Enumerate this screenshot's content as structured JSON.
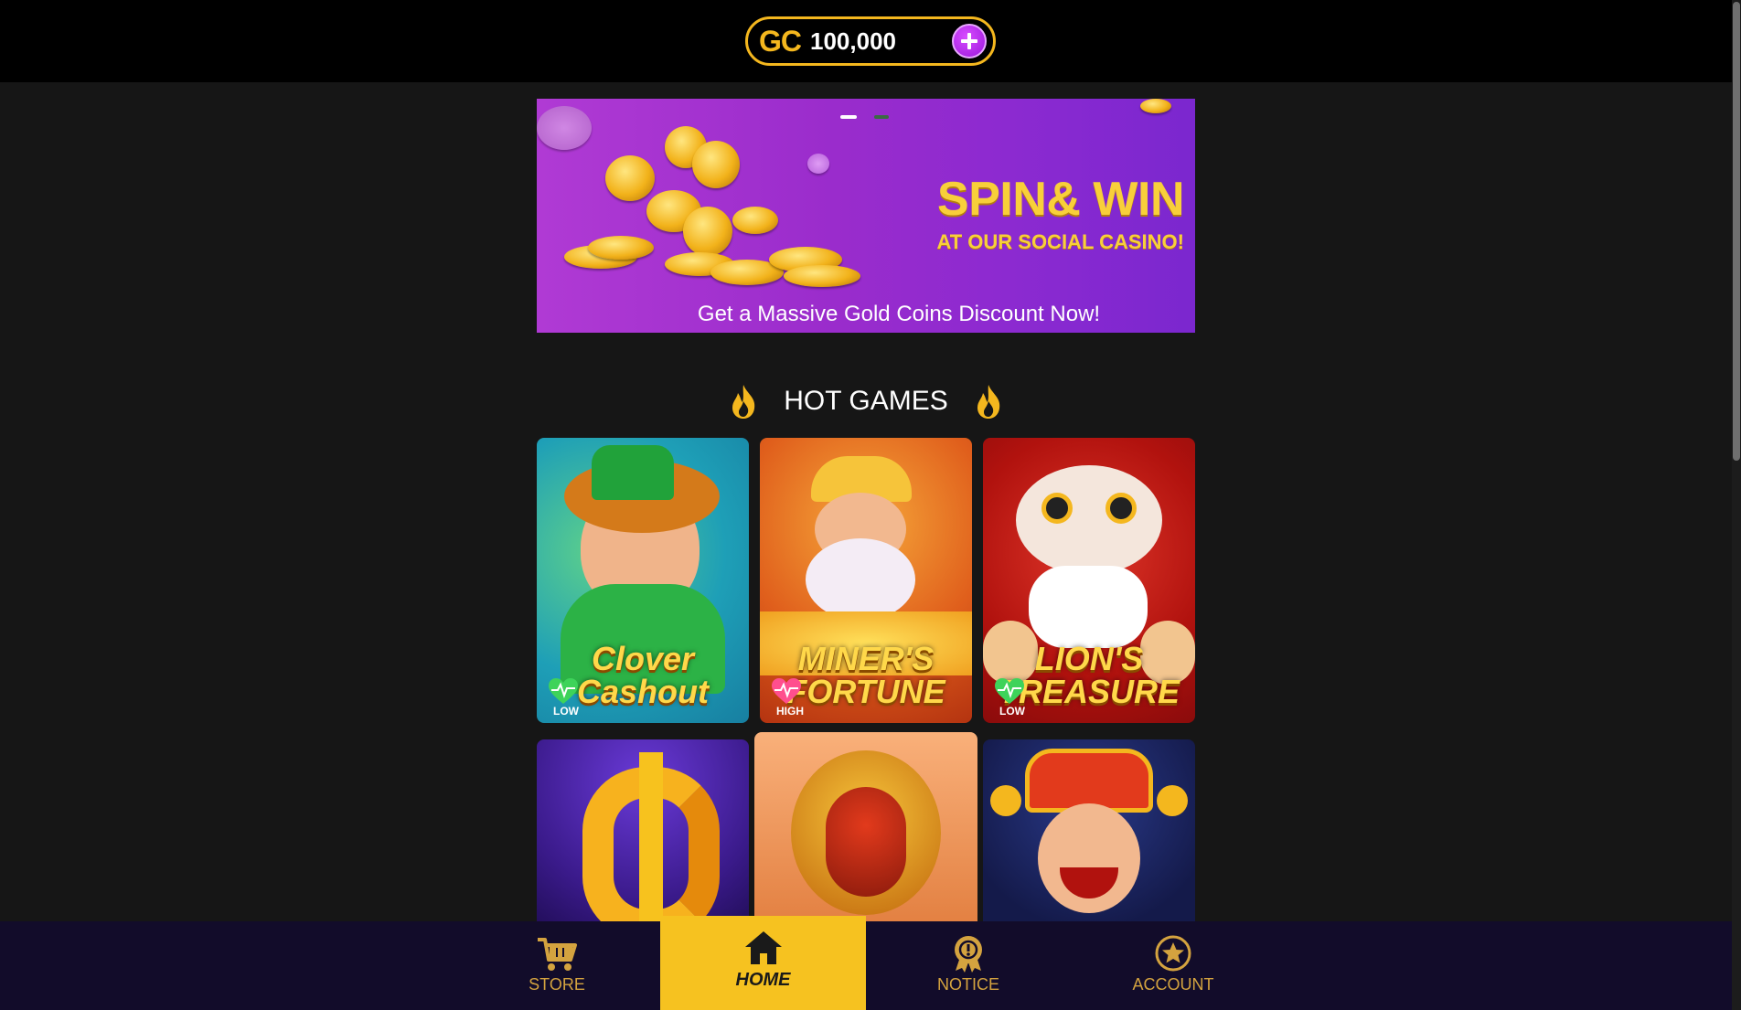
{
  "header": {
    "currency_label": "GC",
    "balance": "100,000",
    "add_icon": "plus-icon"
  },
  "banner": {
    "title": "SPIN& WIN",
    "subtitle": "AT OUR SOCIAL CASINO!",
    "footer": "Get a Massive Gold Coins Discount Now!",
    "slides": 2,
    "active_slide": 1
  },
  "hot_games": {
    "title": "HOT GAMES",
    "icon": "flame-icon",
    "games": [
      {
        "name": "Clover Cashout",
        "volatility": "LOW",
        "volatility_color": "#3ed35a"
      },
      {
        "name": "MINER'S FORTUNE",
        "volatility": "HIGH",
        "volatility_color": "#ff4f8e"
      },
      {
        "name": "LION'S TREASURE",
        "volatility": "LOW",
        "volatility_color": "#3ed35a"
      },
      {
        "name": "",
        "volatility": "",
        "volatility_color": ""
      },
      {
        "name": "",
        "volatility": "",
        "volatility_color": ""
      },
      {
        "name": "",
        "volatility": "",
        "volatility_color": ""
      }
    ]
  },
  "nav": {
    "items": [
      {
        "label": "STORE",
        "icon": "cart-icon"
      },
      {
        "label": "HOME",
        "icon": "home-icon",
        "active": true
      },
      {
        "label": "NOTICE",
        "icon": "badge-icon"
      },
      {
        "label": "ACCOUNT",
        "icon": "star-icon"
      }
    ]
  },
  "colors": {
    "gold": "#f4b71e",
    "nav_bg": "#120c2a",
    "nav_active": "#f6c220",
    "banner_purple": "#9a2ccc"
  }
}
